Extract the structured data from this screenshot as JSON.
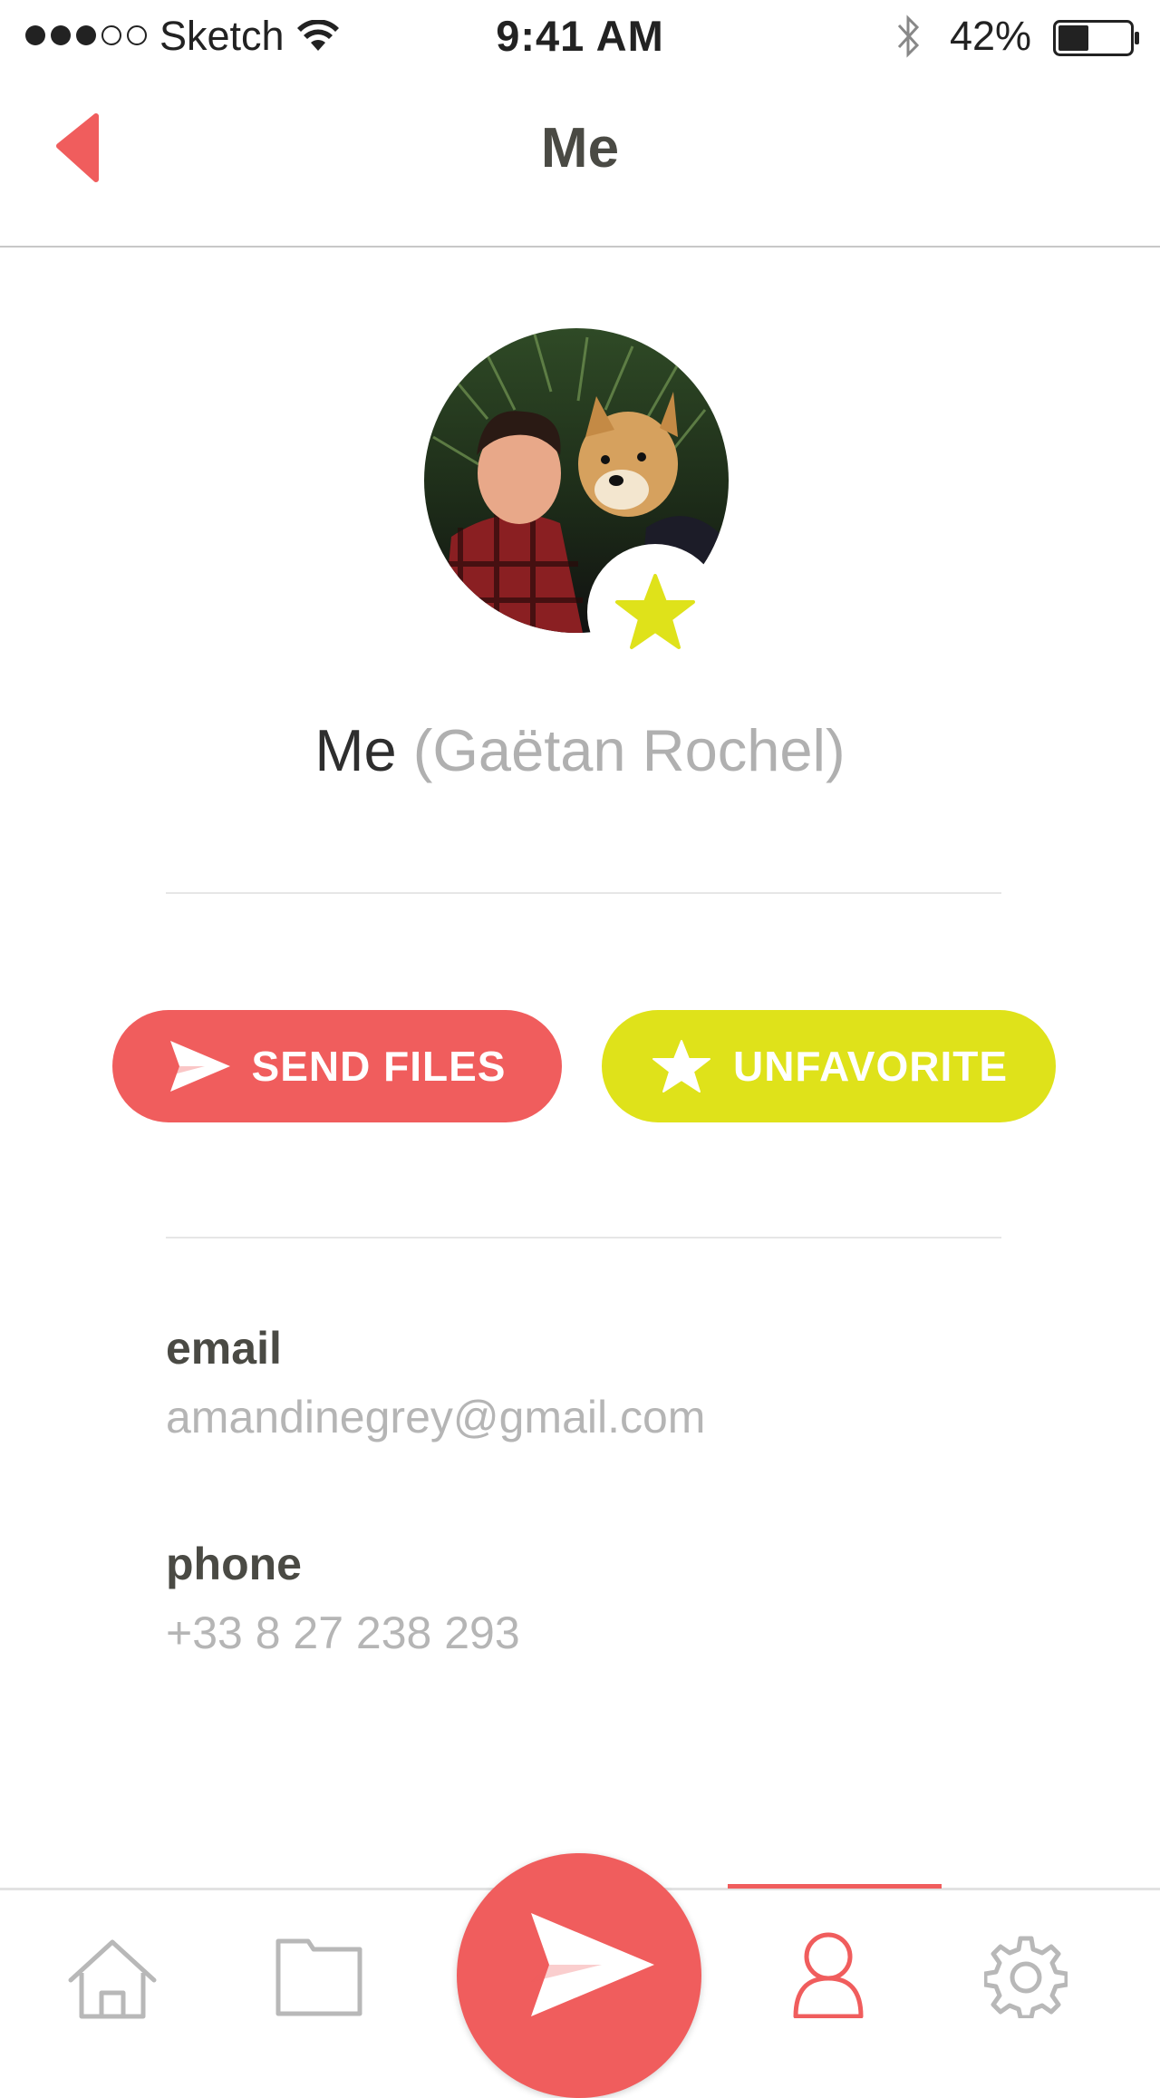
{
  "status_bar": {
    "carrier": "Sketch",
    "time": "9:41 AM",
    "battery_percent": "42%",
    "signal_bars_filled": 3,
    "signal_bars_total": 5,
    "battery_level": 0.42
  },
  "nav": {
    "title": "Me",
    "back_icon": "chevron-left-icon"
  },
  "profile": {
    "display_name": "Me",
    "full_name": "(Gaëtan Rochel)",
    "favorite_icon": "star-icon",
    "avatar_icon": "profile-photo"
  },
  "actions": {
    "send_label": "SEND FILES",
    "send_icon": "paper-plane-icon",
    "unfavorite_label": "UNFAVORITE",
    "unfavorite_icon": "star-icon"
  },
  "fields": {
    "email_label": "email",
    "email_value": "amandinegrey@gmail.com",
    "phone_label": "phone",
    "phone_value": "+33 8 27 238 293"
  },
  "tabbar": {
    "tabs": [
      {
        "icon": "home-icon",
        "active": false
      },
      {
        "icon": "folder-icon",
        "active": false
      },
      {
        "icon": "paper-plane-icon",
        "active": false
      },
      {
        "icon": "user-icon",
        "active": true
      },
      {
        "icon": "gear-icon",
        "active": false
      }
    ]
  },
  "colors": {
    "accent_red": "#f05d5d",
    "accent_yellow": "#dfe21a",
    "text_dark": "#4a4a44",
    "text_muted": "#b5b5b5"
  }
}
